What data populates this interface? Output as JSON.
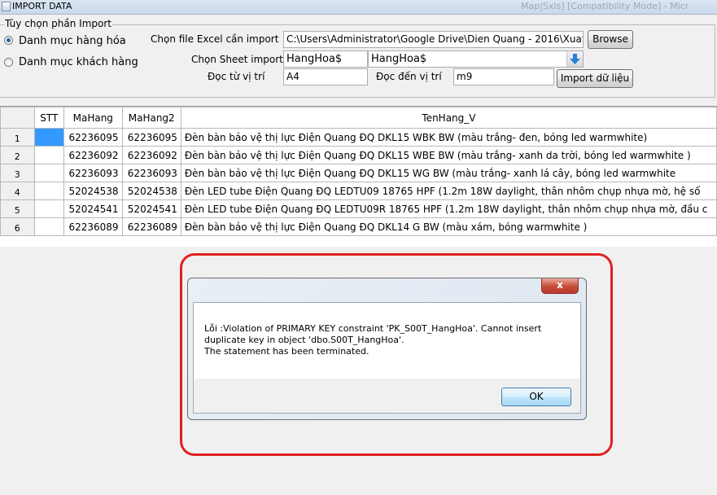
{
  "window": {
    "title": "IMPORT DATA",
    "background_title": "Map|Sxls]  [Compatibility Mode] - Micr"
  },
  "options": {
    "group_title": "Tùy chọn phần Import",
    "radio_products": "Danh mục hàng hóa",
    "radio_customers": "Danh mục khách hàng",
    "selected": "products"
  },
  "form": {
    "file_label": "Chọn file Excel cần import",
    "file_path": "C:\\Users\\Administrator\\Google Drive\\Dien Quang - 2016\\Xuat  n",
    "browse_label": "Browse",
    "sheet_label": "Chọn Sheet import",
    "sheet_value": "HangHoa$",
    "sheet_combo_value": "HangHoa$",
    "from_label": "Đọc từ vị trí",
    "from_value": "A4",
    "to_label": "Đọc đến vị trí",
    "to_value": "m9",
    "import_label": "Import dữ liệu"
  },
  "grid": {
    "columns": [
      "STT",
      "MaHang",
      "MaHang2",
      "TenHang_V"
    ],
    "rows": [
      {
        "num": "1",
        "stt": "",
        "mahang": "62236095",
        "mahang2": "62236095",
        "ten": "Đèn bàn bảo vệ thị lực Điện Quang ĐQ DKL15 WBK BW (màu trắng- đen, bóng led warmwhite)"
      },
      {
        "num": "2",
        "stt": "",
        "mahang": "62236092",
        "mahang2": "62236092",
        "ten": "Đèn bàn bảo vệ thị lực Điện Quang ĐQ DKL15 WBE BW (màu trắng- xanh da trời, bóng led warmwhite )"
      },
      {
        "num": "3",
        "stt": "",
        "mahang": "62236093",
        "mahang2": "62236093",
        "ten": "Đèn bàn bảo vệ thị lực Điện Quang ĐQ DKL15 WG BW (màu trắng- xanh lá cây, bóng led warmwhite"
      },
      {
        "num": "4",
        "stt": "",
        "mahang": "52024538",
        "mahang2": "52024538",
        "ten": "Đèn LED tube Điện Quang ĐQ LEDTU09 18765 HPF (1.2m 18W daylight, thân nhôm chụp nhựa mờ, hệ số"
      },
      {
        "num": "5",
        "stt": "",
        "mahang": "52024541",
        "mahang2": "52024541",
        "ten": "Đèn LED tube Điện Quang ĐQ LEDTU09R 18765 HPF (1.2m 18W daylight, thân nhôm chụp nhựa mờ, đầu c"
      },
      {
        "num": "6",
        "stt": "",
        "mahang": "62236089",
        "mahang2": "62236089",
        "ten": "Đèn bàn bảo vệ thị lực Điện Quang ĐQ DKL14 G BW (màu xám, bóng warmwhite )"
      }
    ]
  },
  "dialog": {
    "close_glyph": "x",
    "line1": "Lỗi :Violation of PRIMARY KEY constraint 'PK_S00T_HangHoa'. Cannot insert",
    "line2": "duplicate key in object 'dbo.S00T_HangHoa'.",
    "line3": "The statement has been terminated.",
    "ok_label": "OK"
  },
  "colors": {
    "highlight": "#e02020",
    "selected_cell": "#3399ff",
    "accent_blue": "#2a7fd4"
  }
}
